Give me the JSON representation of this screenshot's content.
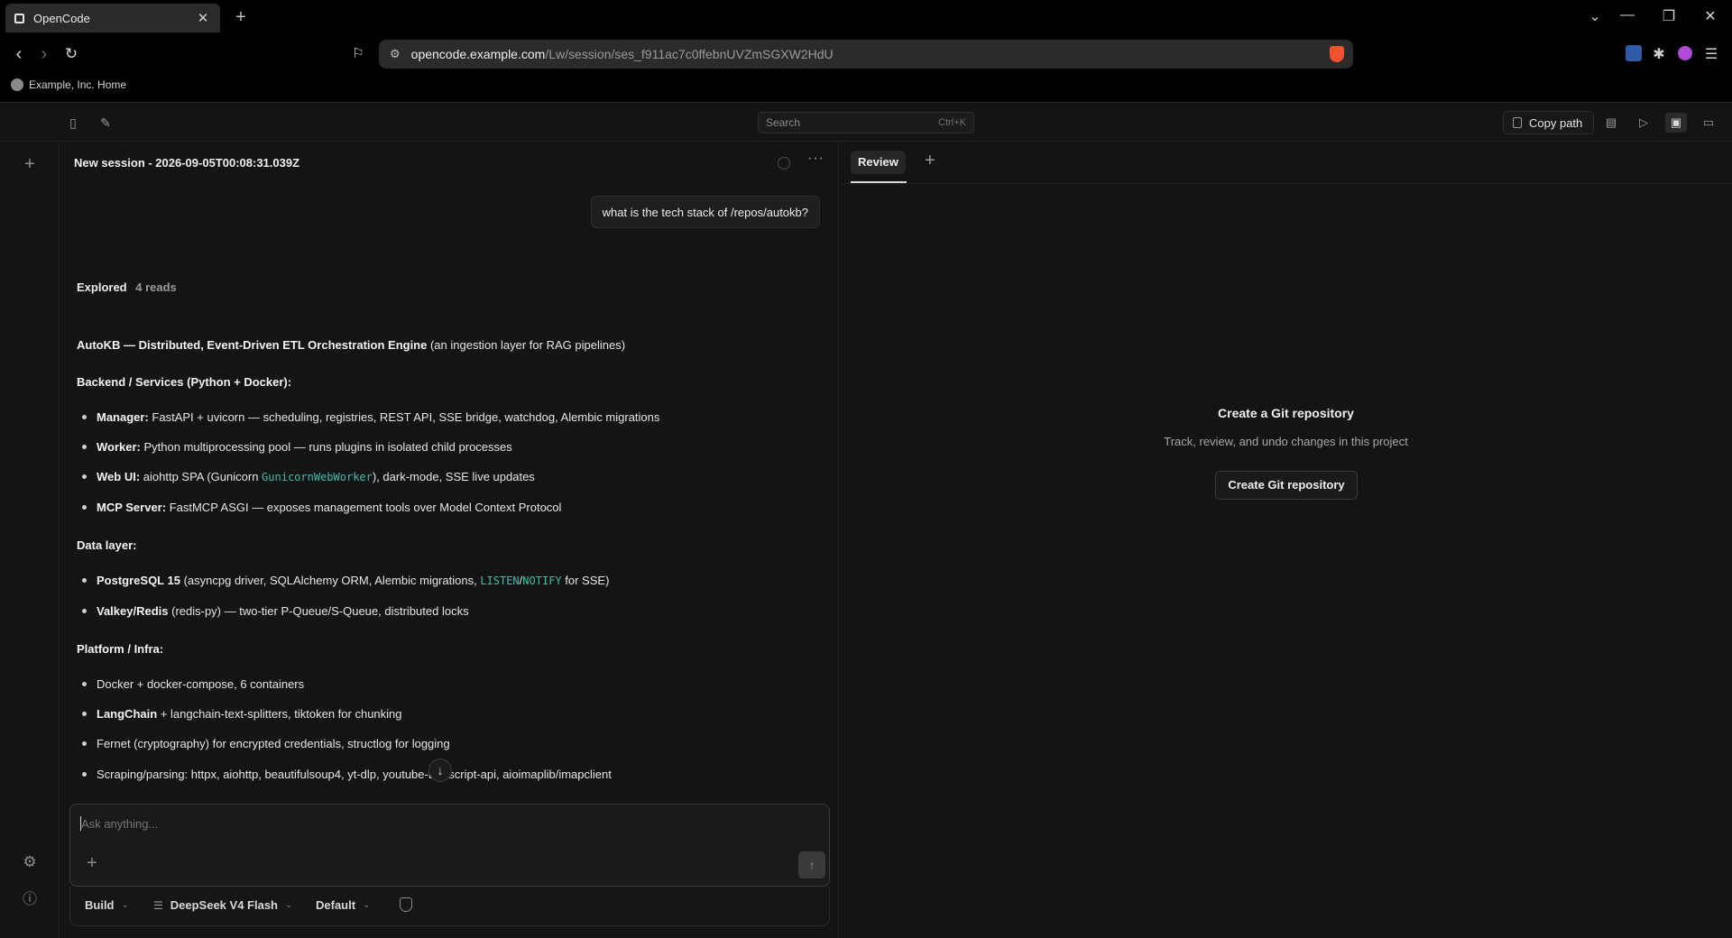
{
  "browser": {
    "tab_title": "OpenCode",
    "url_host": "opencode.example.com",
    "url_path": "/Lw/session/ses_f911ac7c0ffebnUVZmSGXW2HdU",
    "bookmark": "Example, Inc. Home"
  },
  "header": {
    "search_placeholder": "Search",
    "search_shortcut": "Ctrl+K",
    "copy_path_label": "Copy path"
  },
  "session": {
    "title": "New session - 2026-09-05T00:08:31.039Z",
    "user_message": "what is the tech stack of /repos/autokb?",
    "explored_label": "Explored",
    "explored_count": "4 reads",
    "answer": {
      "intro_bold": "AutoKB — Distributed, Event-Driven ETL Orchestration Engine",
      "intro_rest": " (an ingestion layer for RAG pipelines)",
      "backend_heading": "Backend / Services (Python + Docker):",
      "backend": [
        {
          "bold": "Manager:",
          "text": " FastAPI + uvicorn — scheduling, registries, REST API, SSE bridge, watchdog, Alembic migrations"
        },
        {
          "bold": "Worker:",
          "text": " Python multiprocessing pool — runs plugins in isolated child processes"
        },
        {
          "bold": "Web UI:",
          "pre": " aiohttp SPA (Gunicorn ",
          "code": "GunicornWebWorker",
          "post": "), dark-mode, SSE live updates"
        },
        {
          "bold": "MCP Server:",
          "text": " FastMCP ASGI — exposes management tools over Model Context Protocol"
        }
      ],
      "data_heading": "Data layer:",
      "data": [
        {
          "bold": "PostgreSQL 15",
          "pre": " (asyncpg driver, SQLAlchemy ORM, Alembic migrations, ",
          "code1": "LISTEN",
          "sep": "/",
          "code2": "NOTIFY",
          "post": " for SSE)"
        },
        {
          "bold": "Valkey/Redis",
          "text": " (redis-py) — two-tier P-Queue/S-Queue, distributed locks"
        }
      ],
      "platform_heading": "Platform / Infra:",
      "platform": [
        {
          "text": "Docker + docker-compose, 6 containers"
        },
        {
          "bold": "LangChain",
          "text": " + langchain-text-splitters, tiktoken for chunking"
        },
        {
          "text": "Fernet (cryptography) for encrypted credentials, structlog for logging"
        },
        {
          "text": "Scraping/parsing: httpx, aiohttp, beautifulsoup4, yt-dlp, youtube-transcript-api, aioimaplib/imapclient"
        }
      ]
    },
    "composer": {
      "placeholder": "Ask anything...",
      "agent": "Build",
      "model": "DeepSeek V4 Flash",
      "variant": "Default"
    }
  },
  "review": {
    "tab_label": "Review",
    "empty_title": "Create a Git repository",
    "empty_subtitle": "Track, review, and undo changes in this project",
    "button_label": "Create Git repository"
  },
  "colors": {
    "background": "#141414",
    "accent_code": "#3fbfa8",
    "brave": "#f0522d"
  }
}
